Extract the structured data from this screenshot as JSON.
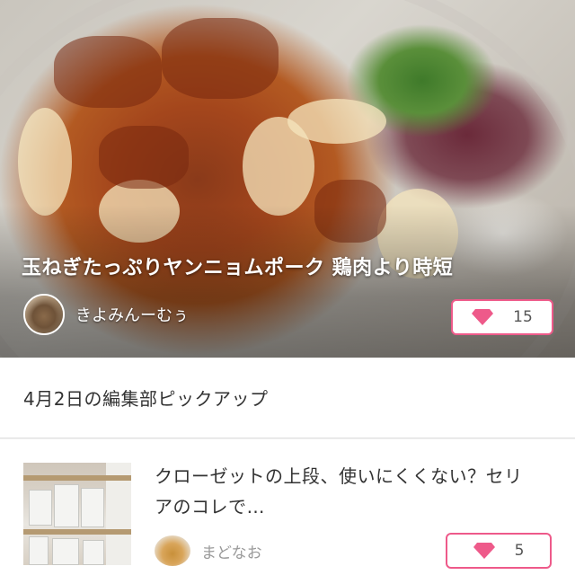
{
  "featured": {
    "title": "玉ねぎたっぷりヤンニョムポーク 鶏肉より時短",
    "author": "きよみんーむぅ",
    "likes": "15",
    "accent_color": "#ee5a8a",
    "image": "glazed-pork-with-onions-photo"
  },
  "section": {
    "title": "4月2日の編集部ピックアップ"
  },
  "articles": [
    {
      "title": "クローゼットの上段、使いにくくない？セリアのコレで…",
      "author": "まどなお",
      "likes": "5",
      "image": "closet-storage-photo"
    }
  ]
}
